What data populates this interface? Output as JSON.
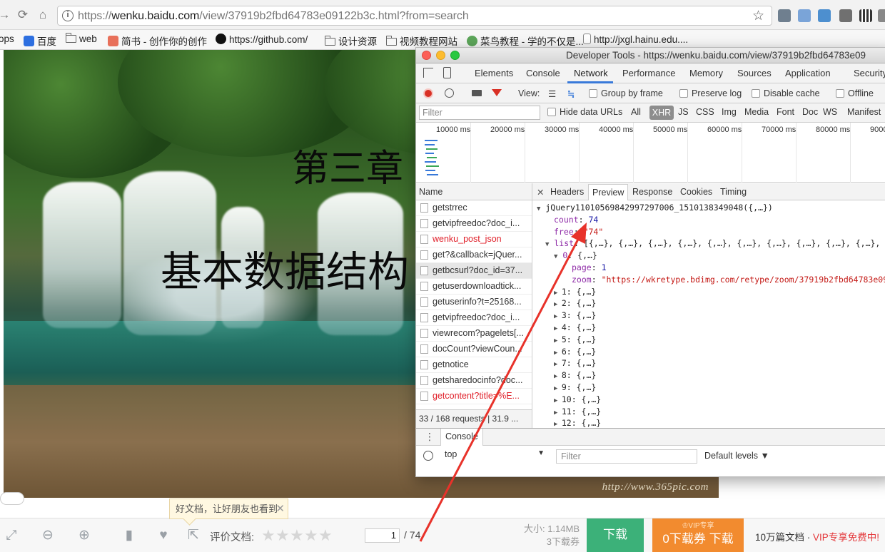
{
  "browser": {
    "url_prefix": "https://",
    "url_host": "wenku.baidu.com",
    "url_path": "/view/37919b2fbd64783e09122b3c.html?from=search"
  },
  "bookmarks": [
    {
      "label": "ops"
    },
    {
      "label": "百度"
    },
    {
      "label": "web"
    },
    {
      "label": "简书 - 创作你的创作"
    },
    {
      "label": "https://github.com/"
    },
    {
      "label": "设计资源"
    },
    {
      "label": "视频教程网站"
    },
    {
      "label": "菜鸟教程 - 学的不仅是..."
    },
    {
      "label": "http://jxgl.hainu.edu...."
    }
  ],
  "document": {
    "title": "第三章",
    "subtitle": "基本数据结构",
    "watermark": "http://www.365pic.com",
    "tooltip": "好文档，让好朋友也看到",
    "rate_label": "评价文档:",
    "stars": 5,
    "page_current": "1",
    "page_total": "/ 74",
    "size": "大小: 1.14MB",
    "downloads": "3下载券",
    "download_button": "下载",
    "vip_tag": "♔VIP专享",
    "vip_button": "0下载券 下载",
    "promo_prefix": "10万篇文档 · ",
    "promo_highlight": "VIP专享免费中!"
  },
  "devtools": {
    "title": "Developer Tools - https://wenku.baidu.com/view/37919b2fbd64783e09",
    "tabs": [
      "Elements",
      "Console",
      "Network",
      "Performance",
      "Memory",
      "Sources",
      "Application",
      "Security"
    ],
    "active_tab": "Network",
    "toolbar": {
      "view_label": "View:",
      "group_by_frame": "Group by frame",
      "preserve_log": "Preserve log",
      "disable_cache": "Disable cache",
      "offline": "Offline"
    },
    "filter": {
      "placeholder": "Filter",
      "hide_data_urls": "Hide data URLs",
      "types": [
        "All",
        "XHR",
        "JS",
        "CSS",
        "Img",
        "Media",
        "Font",
        "Doc",
        "WS",
        "Manifest"
      ],
      "active_type": "XHR"
    },
    "timeline_ticks": [
      "10000 ms",
      "20000 ms",
      "30000 ms",
      "40000 ms",
      "50000 ms",
      "60000 ms",
      "70000 ms",
      "80000 ms",
      "9000"
    ],
    "name_header": "Name",
    "requests": [
      {
        "name": "getstrrec",
        "error": false
      },
      {
        "name": "getvipfreedoc?doc_i...",
        "error": false
      },
      {
        "name": "wenku_post_json",
        "error": true
      },
      {
        "name": "get?&callback=jQuer...",
        "error": false
      },
      {
        "name": "getbcsurl?doc_id=37...",
        "error": false,
        "selected": true
      },
      {
        "name": "getuserdownloadtick...",
        "error": false
      },
      {
        "name": "getuserinfo?t=25168...",
        "error": false
      },
      {
        "name": "getvipfreedoc?doc_i...",
        "error": false
      },
      {
        "name": "viewrecom?pagelets[...",
        "error": false
      },
      {
        "name": "docCount?viewCoun...",
        "error": false
      },
      {
        "name": "getnotice",
        "error": false
      },
      {
        "name": "getsharedocinfo?doc...",
        "error": false
      },
      {
        "name": "getcontent?title=%E...",
        "error": true
      }
    ],
    "summary": "33 / 168 requests | 31.9 ...",
    "detail_tabs": [
      "Headers",
      "Preview",
      "Response",
      "Cookies",
      "Timing"
    ],
    "active_detail_tab": "Preview",
    "preview": {
      "root": "jQuery11010569842997297006_1510138349048({,…})",
      "count_key": "count",
      "count_value": "74",
      "free_key": "free",
      "free_value": "\"74\"",
      "list_key": "list",
      "list_value": "[{,…}, {,…}, {,…}, {,…}, {,…}, {,…}, {,…}, {,…}, {,…}, {,…},",
      "item0_key": "0",
      "item0_value": "{,…}",
      "page_key": "page",
      "page_value": "1",
      "zoom_key": "zoom",
      "zoom_value": "\"https://wkretype.bdimg.com/retype/zoom/37919b2fbd64783e09",
      "collapsed_items": [
        "1: {,…}",
        "2: {,…}",
        "3: {,…}",
        "4: {,…}",
        "5: {,…}",
        "6: {,…}",
        "7: {,…}",
        "8: {,…}",
        "9: {,…}",
        "10: {,…}",
        "11: {,…}",
        "12: {,…}"
      ]
    },
    "console": {
      "tab": "Console",
      "context": "top",
      "filter_placeholder": "Filter",
      "levels": "Default levels ▼"
    }
  },
  "colors": {
    "annotation_arrow": "#e8322a",
    "devtools_accent": "#3879d9",
    "download_green": "#3cb179",
    "vip_orange": "#f28b2f"
  }
}
